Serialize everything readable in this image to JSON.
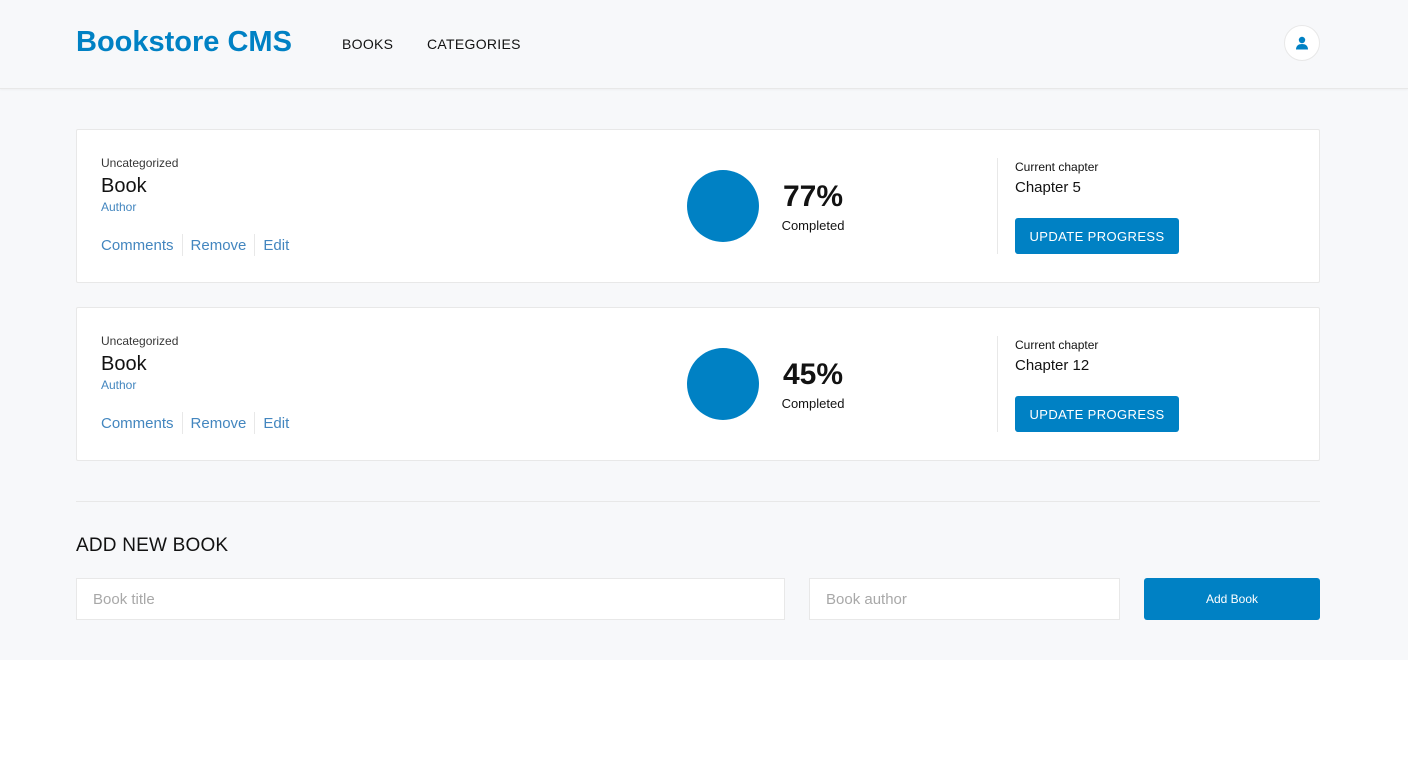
{
  "header": {
    "brand": "Bookstore CMS",
    "nav": [
      {
        "label": "BOOKS"
      },
      {
        "label": "CATEGORIES"
      }
    ],
    "user_icon": "user-icon"
  },
  "books": [
    {
      "category": "Uncategorized",
      "title": "Book",
      "author": "Author",
      "actions": [
        "Comments",
        "Remove",
        "Edit"
      ],
      "progress_percent": 77,
      "percent_label": "77%",
      "completed_label": "Completed",
      "chapter_label": "Current chapter",
      "chapter": "Chapter 5",
      "update_label": "UPDATE PROGRESS"
    },
    {
      "category": "Uncategorized",
      "title": "Book",
      "author": "Author",
      "actions": [
        "Comments",
        "Remove",
        "Edit"
      ],
      "progress_percent": 45,
      "percent_label": "45%",
      "completed_label": "Completed",
      "chapter_label": "Current chapter",
      "chapter": "Chapter 12",
      "update_label": "UPDATE PROGRESS"
    }
  ],
  "form": {
    "title": "ADD NEW BOOK",
    "title_placeholder": "Book title",
    "author_placeholder": "Book author",
    "submit_label": "Add Book"
  },
  "colors": {
    "accent": "#0081c4",
    "link": "#4386bf",
    "background": "#f7f8fa"
  }
}
